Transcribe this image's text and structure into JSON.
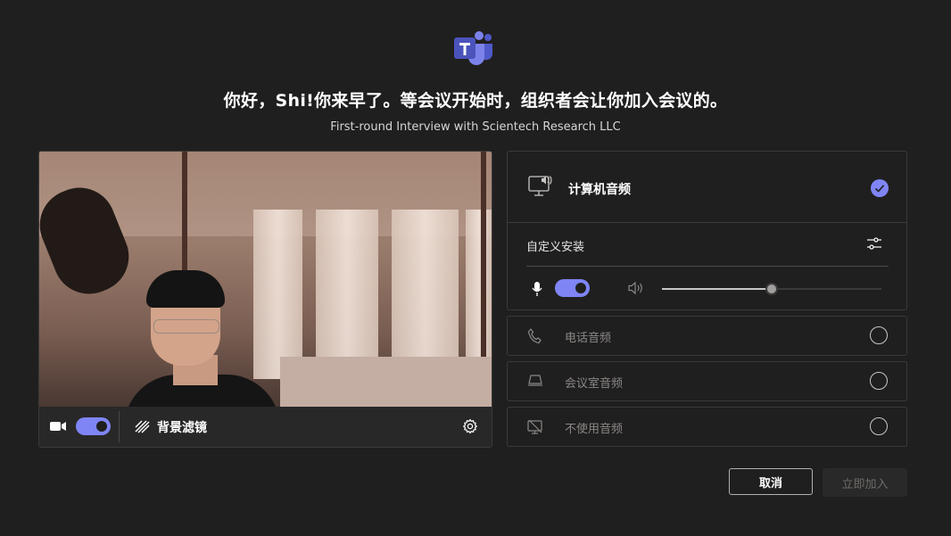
{
  "header": {
    "logo_icon": "teams-logo-icon",
    "greeting": "你好，Shi!你来早了。等会议开始时，组织者会让你加入会议的。",
    "meeting_title": "First-round Interview with Scientech Research LLC"
  },
  "video": {
    "camera_on": true,
    "background_filter_label": "背景滤镜",
    "icons": [
      "camera-icon",
      "background-filter-icon",
      "settings-gear-icon"
    ]
  },
  "audio": {
    "computer_audio": {
      "label": "计算机音频",
      "selected": true,
      "custom_setup_label": "自定义安装",
      "mic_on": true,
      "volume_level": 0.5
    },
    "options": [
      {
        "label": "电话音频",
        "icon": "phone-icon",
        "selected": false
      },
      {
        "label": "会议室音频",
        "icon": "room-device-icon",
        "selected": false
      },
      {
        "label": "不使用音频",
        "icon": "no-audio-icon",
        "selected": false
      }
    ]
  },
  "actions": {
    "cancel_label": "取消",
    "join_label": "立即加入",
    "join_enabled": false
  },
  "colors": {
    "background": "#201f1f",
    "accent": "#7f85f5",
    "border": "#3b3a39"
  }
}
